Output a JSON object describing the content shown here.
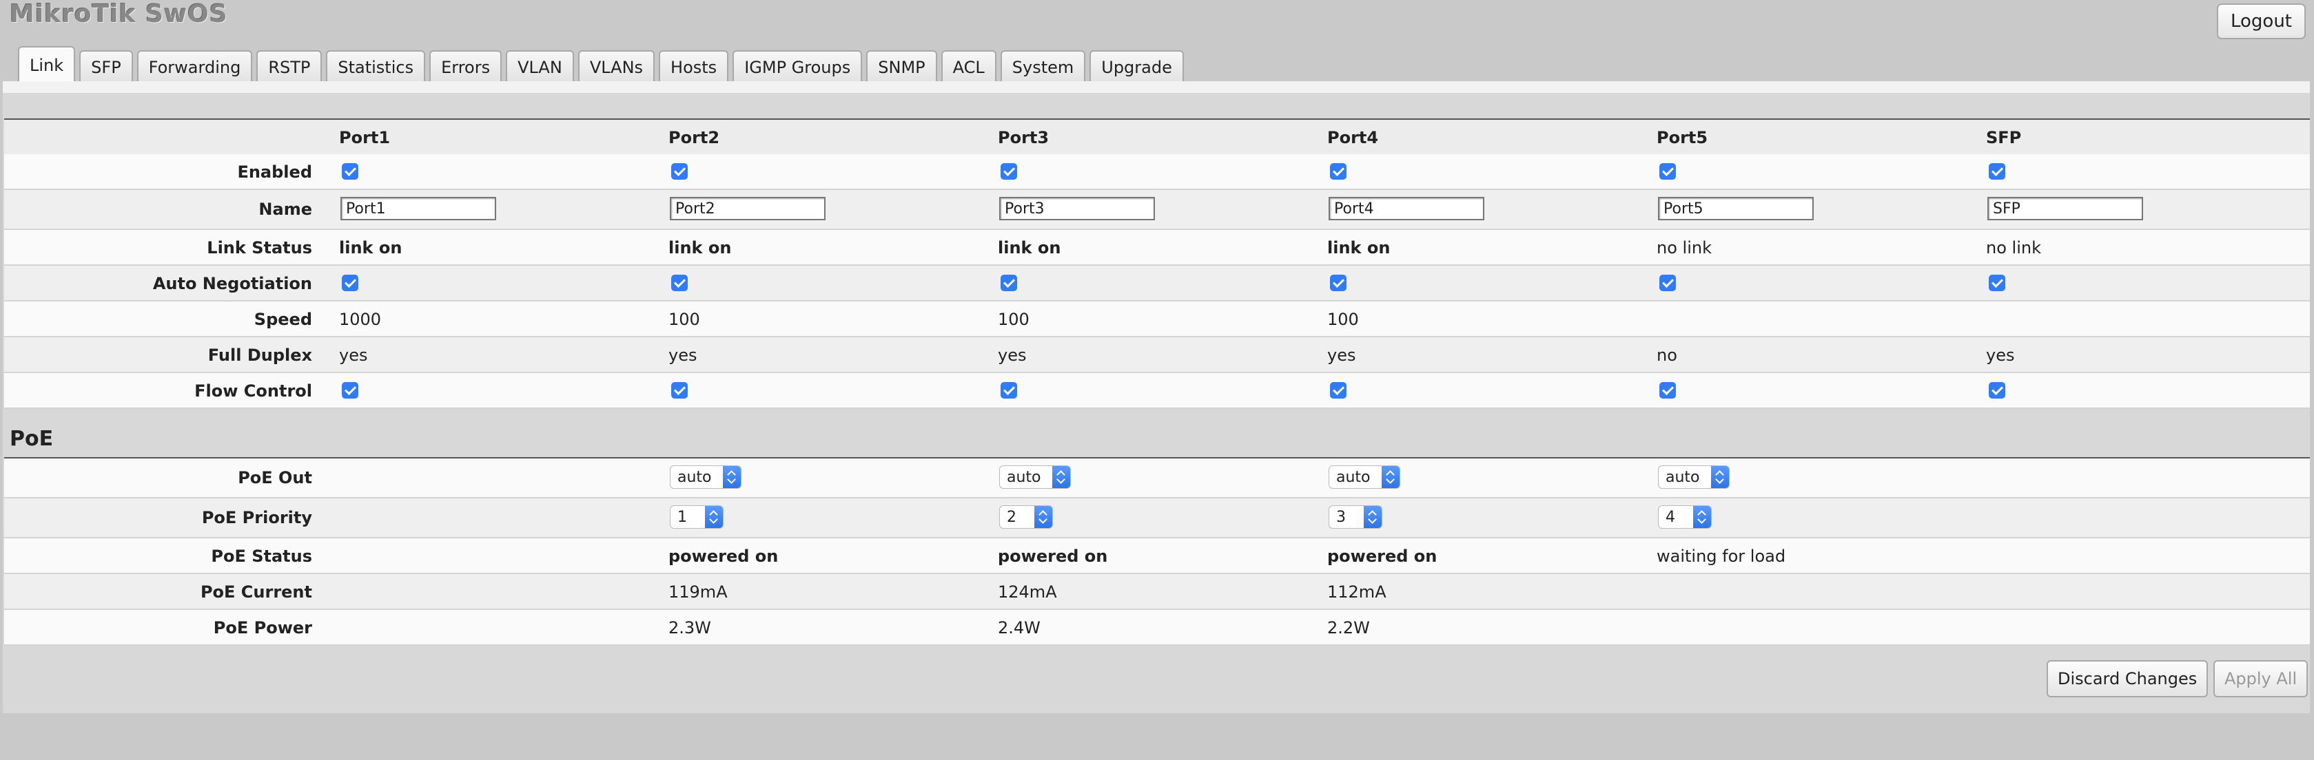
{
  "app": {
    "title": "MikroTik SwOS",
    "logout_label": "Logout"
  },
  "tabs": [
    "Link",
    "SFP",
    "Forwarding",
    "RSTP",
    "Statistics",
    "Errors",
    "VLAN",
    "VLANs",
    "Hosts",
    "IGMP Groups",
    "SNMP",
    "ACL",
    "System",
    "Upgrade"
  ],
  "active_tab": "Link",
  "link": {
    "headers": [
      "Port1",
      "Port2",
      "Port3",
      "Port4",
      "Port5",
      "SFP"
    ],
    "labels": {
      "enabled": "Enabled",
      "name": "Name",
      "link_status": "Link Status",
      "auto_negotiation": "Auto Negotiation",
      "speed": "Speed",
      "full_duplex": "Full Duplex",
      "flow_control": "Flow Control"
    },
    "names": [
      "Port1",
      "Port2",
      "Port3",
      "Port4",
      "Port5",
      "SFP"
    ],
    "link_status": [
      "link on",
      "link on",
      "link on",
      "link on",
      "no link",
      "no link"
    ],
    "speed": [
      "1000",
      "100",
      "100",
      "100",
      "",
      ""
    ],
    "full_duplex": [
      "yes",
      "yes",
      "yes",
      "yes",
      "no",
      "yes"
    ]
  },
  "poe": {
    "section_title": "PoE",
    "labels": {
      "out": "PoE Out",
      "priority": "PoE Priority",
      "status": "PoE Status",
      "current": "PoE Current",
      "power": "PoE Power"
    },
    "out": [
      "",
      "auto",
      "auto",
      "auto",
      "auto",
      ""
    ],
    "priority": [
      "",
      "1",
      "2",
      "3",
      "4",
      ""
    ],
    "status": [
      "",
      "powered on",
      "powered on",
      "powered on",
      "waiting for load",
      ""
    ],
    "current": [
      "",
      "119mA",
      "124mA",
      "112mA",
      "",
      ""
    ],
    "power": [
      "",
      "2.3W",
      "2.4W",
      "2.2W",
      "",
      ""
    ]
  },
  "actions": {
    "discard": "Discard Changes",
    "apply": "Apply All"
  }
}
